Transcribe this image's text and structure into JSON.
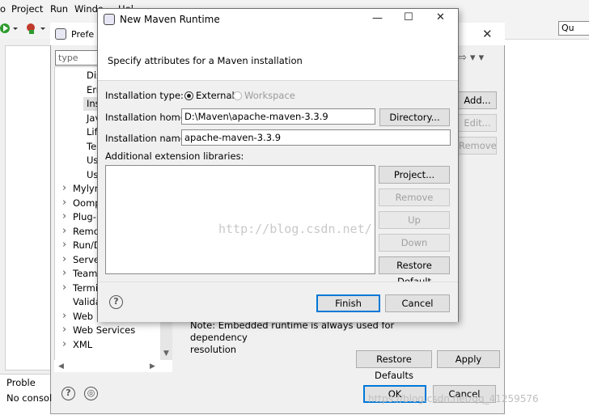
{
  "menubar": {
    "items": [
      "o",
      "Project",
      "Run",
      "Windo",
      "Hel"
    ]
  },
  "toolbar": {
    "quick_access": "Qu"
  },
  "preferences": {
    "title": "Prefe",
    "filter_placeholder": "type filter",
    "tree": [
      {
        "label": "Dis",
        "indent": 2
      },
      {
        "label": "Err",
        "indent": 2
      },
      {
        "label": "Ins",
        "indent": 2,
        "selected": true
      },
      {
        "label": "Jav",
        "indent": 2
      },
      {
        "label": "Life",
        "indent": 2
      },
      {
        "label": "Ter",
        "indent": 2
      },
      {
        "label": "Us",
        "indent": 2
      },
      {
        "label": "Us",
        "indent": 2
      },
      {
        "label": "Mylyn",
        "indent": 1,
        "expandable": true
      },
      {
        "label": "Oomp",
        "indent": 1,
        "expandable": true
      },
      {
        "label": "Plug-i",
        "indent": 1,
        "expandable": true
      },
      {
        "label": "Remot",
        "indent": 1,
        "expandable": true
      },
      {
        "label": "Run/D",
        "indent": 1,
        "expandable": true
      },
      {
        "label": "Server",
        "indent": 1,
        "expandable": true
      },
      {
        "label": "Team",
        "indent": 1,
        "expandable": true
      },
      {
        "label": "Termi",
        "indent": 1,
        "expandable": true
      },
      {
        "label": "Valida",
        "indent": 1,
        "expandable": false
      },
      {
        "label": "Web",
        "indent": 1,
        "expandable": true
      },
      {
        "label": "Web Services",
        "indent": 1,
        "expandable": true
      },
      {
        "label": "XML",
        "indent": 1,
        "expandable": true
      }
    ],
    "buttons": {
      "add": "Add...",
      "edit": "Edit...",
      "remove": "Remove",
      "restore_defaults": "Restore Defaults",
      "apply": "Apply",
      "ok": "OK",
      "cancel": "Cancel"
    },
    "note_line1": "Note: Embedded runtime is always used for dependency",
    "note_line2": "resolution"
  },
  "problems": {
    "tab": "Proble",
    "text": "No consol"
  },
  "dialog": {
    "title": "New Maven Runtime",
    "description": "Specify attributes for a Maven installation",
    "installation_type_label": "Installation type:",
    "type_external": "External",
    "type_workspace": "Workspace",
    "selected_type": "External",
    "home_label": "Installation home:",
    "home_value": "D:\\Maven\\apache-maven-3.3.9",
    "directory_button": "Directory...",
    "name_label": "Installation name:",
    "name_value": "apache-maven-3.3.9",
    "ext_label": "Additional extension libraries:",
    "side_buttons": {
      "project": "Project...",
      "remove": "Remove",
      "up": "Up",
      "down": "Down",
      "restore": "Restore Default"
    },
    "finish": "Finish",
    "cancel": "Cancel"
  },
  "watermark": "http://blog.csdn.net/",
  "watermark2": "https://blog.csdn.net/qq_41259576"
}
